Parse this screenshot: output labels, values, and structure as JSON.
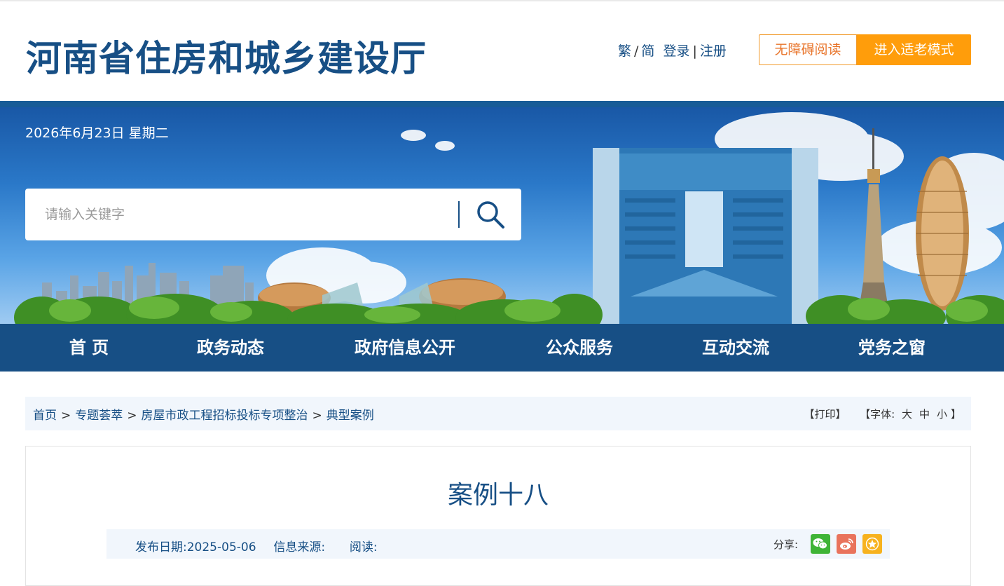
{
  "header": {
    "site_title": "河南省住房和城乡建设厅",
    "lang_trad": "繁",
    "lang_sep": "/",
    "lang_simp": "简",
    "login": "登录",
    "auth_sep": "|",
    "register": "注册",
    "accessible_reading": "无障碍阅读",
    "elder_mode": "进入适老模式"
  },
  "banner": {
    "date": "2026年6月23日 星期二",
    "search_placeholder": "请输入关键字",
    "search_icon": "search-icon"
  },
  "nav": {
    "items": [
      {
        "label": "首 页"
      },
      {
        "label": "政务动态"
      },
      {
        "label": "政府信息公开"
      },
      {
        "label": "公众服务"
      },
      {
        "label": "互动交流"
      },
      {
        "label": "党务之窗"
      }
    ]
  },
  "breadcrumb": {
    "items": [
      "首页",
      "专题荟萃",
      "房屋市政工程招标投标专项整治",
      "典型案例"
    ],
    "separator": ">",
    "print": "【打印】",
    "font_label": "【字体:",
    "font_large": "大",
    "font_medium": "中",
    "font_small": "小",
    "font_close": "】"
  },
  "article": {
    "title": "案例十八",
    "publish_label": "发布日期:",
    "publish_date": "2025-05-06",
    "source_label": "信息来源:",
    "source_value": "",
    "views_label": "阅读:",
    "views_value": "",
    "share_label": "分享:",
    "share_icons": [
      "wechat-icon",
      "weibo-icon",
      "favorite-icon"
    ]
  },
  "colors": {
    "brand_blue": "#174f85",
    "orange": "#ff9d0b",
    "orange_text": "#e8742a",
    "light_bg": "#f1f6fc"
  }
}
